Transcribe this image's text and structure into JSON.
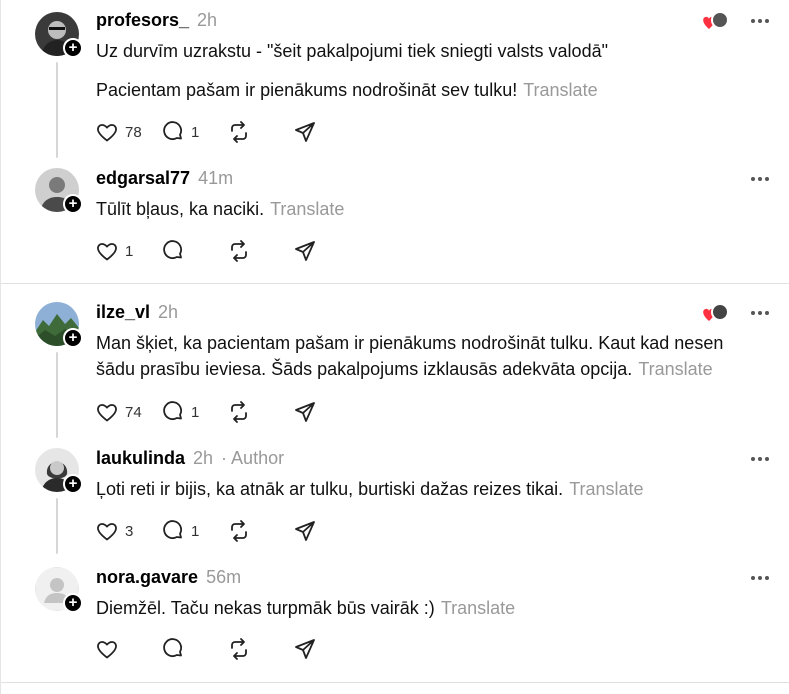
{
  "posts": [
    {
      "username": "profesors_",
      "time": "2h",
      "author_tag": "",
      "text": "Uz durvīm uzrakstu - \"šeit pakalpojumi tiek sniegti valsts valodā\"",
      "text2": "Pacientam pašam ir pienākums nodrošināt sev tulku!",
      "translate": "Translate",
      "likes": "78",
      "replies": "1",
      "reposts": "",
      "shares": ""
    },
    {
      "username": "edgarsal77",
      "time": "41m",
      "author_tag": "",
      "text": "Tūlīt bļaus, ka naciki.",
      "translate": "Translate",
      "likes": "1",
      "replies": "",
      "reposts": "",
      "shares": ""
    },
    {
      "username": "ilze_vl",
      "time": "2h",
      "author_tag": "",
      "text": "Man šķiet, ka pacientam pašam ir pienākums nodrošināt tulku. Kaut kad nesen šādu prasību ieviesa. Šāds pakalpojums izklausās adekvāta opcija.",
      "translate": "Translate",
      "likes": "74",
      "replies": "1",
      "reposts": "",
      "shares": ""
    },
    {
      "username": "laukulinda",
      "time": "2h",
      "author_tag": "· Author",
      "text": "Ļoti reti ir bijis, ka atnāk ar tulku, burtiski dažas reizes tikai.",
      "translate": "Translate",
      "likes": "3",
      "replies": "1",
      "reposts": "",
      "shares": ""
    },
    {
      "username": "nora.gavare",
      "time": "56m",
      "author_tag": "",
      "text": "Diemžēl. Taču nekas turpmāk būs vairāk :)",
      "translate": "Translate",
      "likes": "",
      "replies": "",
      "reposts": "",
      "shares": ""
    }
  ],
  "icons": {
    "like": "heart-icon",
    "reply": "comment-icon",
    "repost": "repost-icon",
    "share": "send-icon",
    "more": "more-icon"
  },
  "colors": {
    "accent_like": "#ff3040",
    "muted": "#999999"
  }
}
